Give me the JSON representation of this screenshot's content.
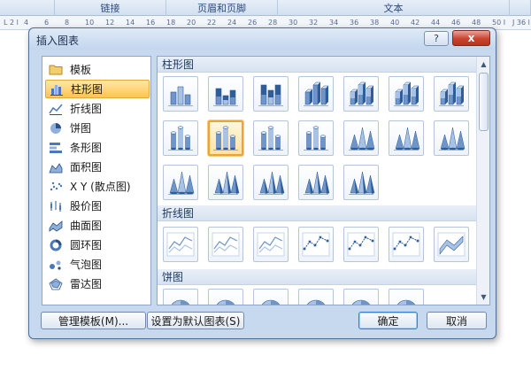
{
  "ribbon": {
    "groups": [
      {
        "label": ""
      },
      {
        "label": "链接"
      },
      {
        "label": "页眉和页脚"
      },
      {
        "label": "文本"
      },
      {
        "label": ""
      }
    ]
  },
  "ruler": {
    "marks": [
      "L 2 l",
      "4",
      "6",
      "8",
      "10",
      "12",
      "14",
      "16",
      "18",
      "20",
      "22",
      "24",
      "26",
      "28",
      "30",
      "32",
      "34",
      "36",
      "38",
      "40",
      "42",
      "44",
      "46",
      "48",
      "50 I",
      "J 36 l"
    ]
  },
  "dialog": {
    "title": "插入图表",
    "help_label": "?",
    "close_label": "x"
  },
  "categories": [
    {
      "label": "模板",
      "icon": "folder-icon",
      "selected": false
    },
    {
      "label": "柱形图",
      "icon": "column-chart-icon",
      "selected": true
    },
    {
      "label": "折线图",
      "icon": "line-chart-icon",
      "selected": false
    },
    {
      "label": "饼图",
      "icon": "pie-chart-icon",
      "selected": false
    },
    {
      "label": "条形图",
      "icon": "bar-chart-icon",
      "selected": false
    },
    {
      "label": "面积图",
      "icon": "area-chart-icon",
      "selected": false
    },
    {
      "label": "X Y (散点图)",
      "icon": "scatter-chart-icon",
      "selected": false
    },
    {
      "label": "股价图",
      "icon": "stock-chart-icon",
      "selected": false
    },
    {
      "label": "曲面图",
      "icon": "surface-chart-icon",
      "selected": false
    },
    {
      "label": "圆环图",
      "icon": "doughnut-chart-icon",
      "selected": false
    },
    {
      "label": "气泡图",
      "icon": "bubble-chart-icon",
      "selected": false
    },
    {
      "label": "雷达图",
      "icon": "radar-chart-icon",
      "selected": false
    }
  ],
  "gallery": {
    "sections": [
      {
        "label": "柱形图"
      },
      {
        "label": "折线图"
      },
      {
        "label": "饼图"
      }
    ],
    "column_thumbs": [
      "clustered-column-icon",
      "stacked-column-icon",
      "100-stacked-column-icon",
      "3d-clustered-column-icon",
      "3d-stacked-column-icon",
      "3d-100-stacked-column-icon",
      "3d-column-icon",
      "clustered-cylinder-icon",
      "stacked-cylinder-icon",
      "100-stacked-cylinder-icon",
      "3d-cylinder-icon",
      "clustered-cone-icon",
      "stacked-cone-icon",
      "100-stacked-cone-icon",
      "3d-cone-icon",
      "clustered-pyramid-icon",
      "stacked-pyramid-icon",
      "100-stacked-pyramid-icon",
      "3d-pyramid-icon"
    ],
    "selected_thumb_index": 8,
    "line_thumbs": [
      "line-icon",
      "stacked-line-icon",
      "100-stacked-line-icon",
      "line-markers-icon",
      "stacked-line-markers-icon",
      "100-stacked-line-markers-icon",
      "3d-line-icon"
    ],
    "pie_thumbs": [
      "pie-icon",
      "3d-pie-icon",
      "pie-of-pie-icon",
      "exploded-pie-icon",
      "3d-exploded-pie-icon",
      "bar-of-pie-icon"
    ]
  },
  "scrollbar": {
    "up": "▲",
    "down": "▼"
  },
  "buttons": {
    "manage_templates": "管理模板(M)...",
    "set_default": "设置为默认图表(S)",
    "ok": "确定",
    "cancel": "取消"
  },
  "colors": {
    "accent_selection": "#ffd477",
    "chart_blue": "#6f95c9",
    "chart_dark_blue": "#2f5d9a",
    "dialog_bg": "#c6d9ef",
    "close_red": "#c9452e"
  }
}
